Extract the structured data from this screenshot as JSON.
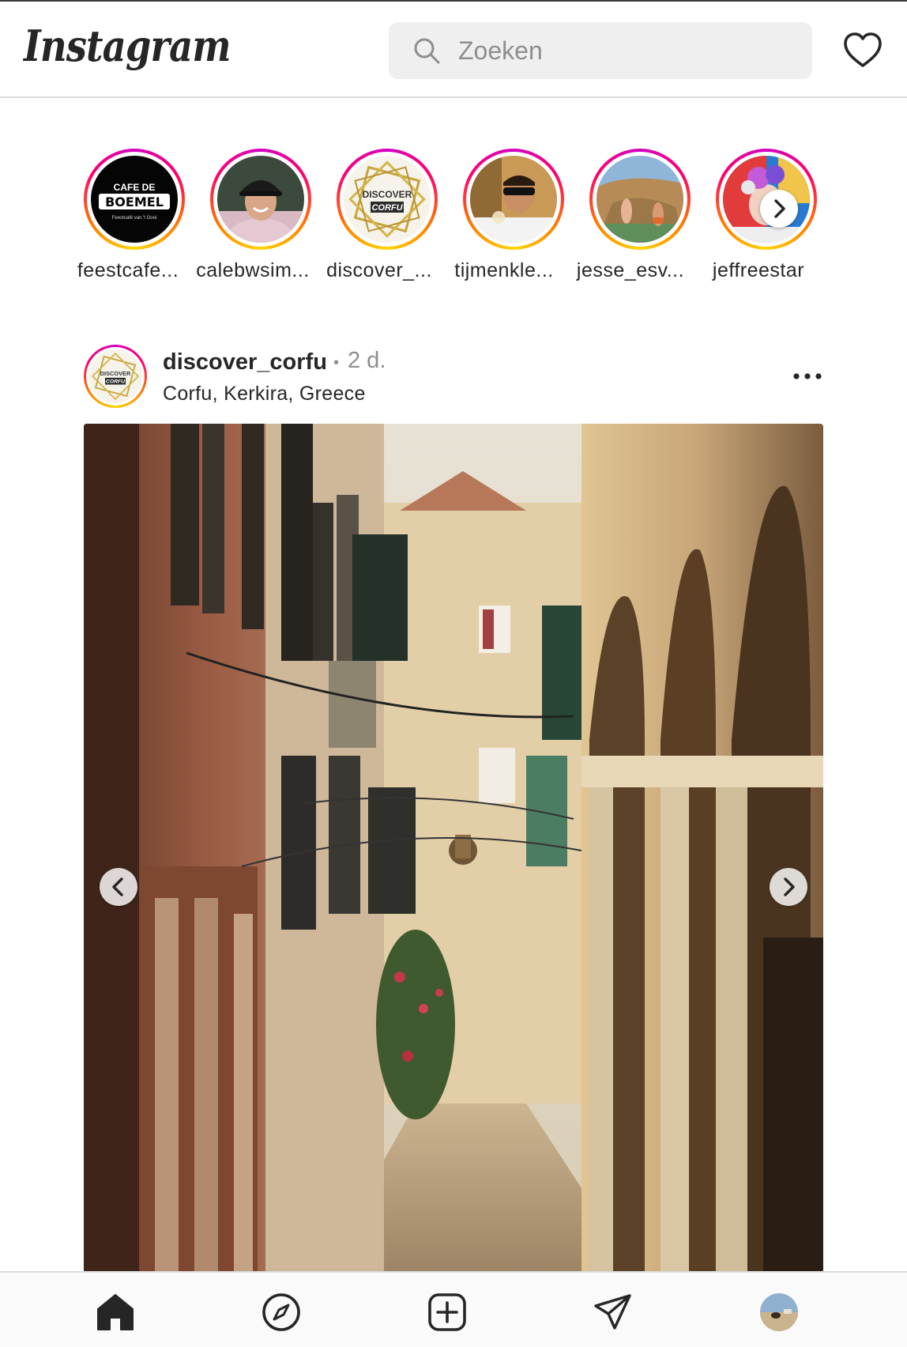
{
  "header": {
    "logo_text": "Instagram",
    "search_placeholder": "Zoeken",
    "icons": {
      "search": "search-icon",
      "activity": "heart-icon"
    }
  },
  "stories": [
    {
      "username": "feestcafe...",
      "avatar_text": "CAFE DE BOEMEL",
      "avatar_subtext": "Feestcafé van 't Gooi"
    },
    {
      "username": "calebwsim..."
    },
    {
      "username": "discover_...",
      "avatar_text": "DISCOVER CORFU"
    },
    {
      "username": "tijmenkle..."
    },
    {
      "username": "jesse_esv..."
    },
    {
      "username": "jeffreestar"
    }
  ],
  "post": {
    "username": "discover_corfu",
    "separator": "•",
    "time_ago": "2 d.",
    "location": "Corfu, Kerkira, Greece",
    "avatar_text": "DISCOVER CORFU"
  },
  "bottom_nav": [
    {
      "icon": "home-icon"
    },
    {
      "icon": "compass-icon"
    },
    {
      "icon": "new-post-icon"
    },
    {
      "icon": "direct-message-icon"
    },
    {
      "icon": "profile-avatar"
    }
  ],
  "colors": {
    "story_ring": [
      "#d300c5",
      "#ff0069",
      "#ff7a00",
      "#ffd600"
    ],
    "text_primary": "#262626",
    "text_secondary": "#8e8e8e",
    "search_bg": "#efefef"
  }
}
